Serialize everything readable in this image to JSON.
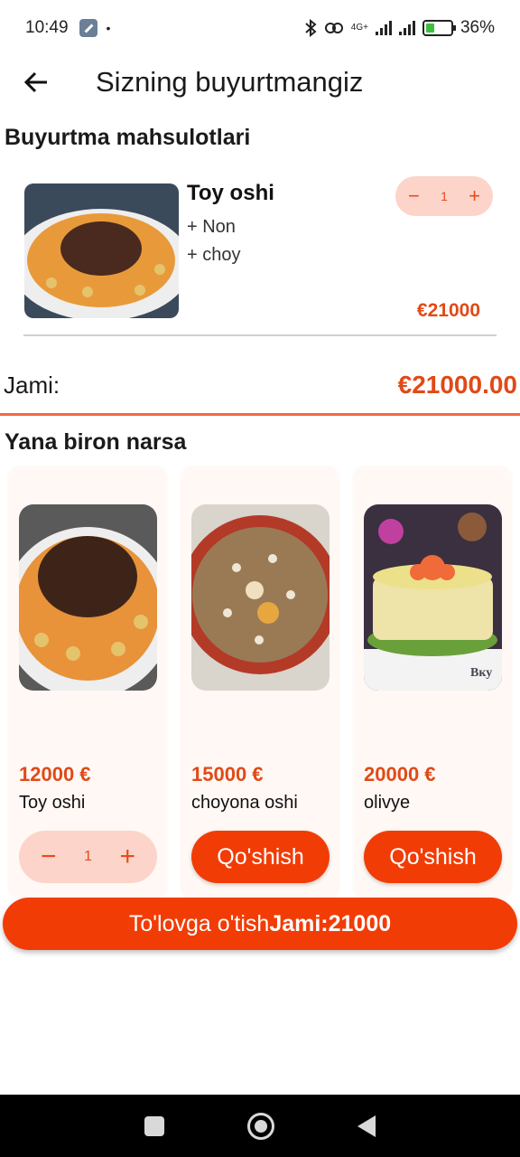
{
  "status_bar": {
    "time": "10:49",
    "dot": "•",
    "network": "4G+",
    "battery": "36%",
    "battery_level": 0.36
  },
  "app_bar": {
    "title": "Sizning buyurtmangiz"
  },
  "order_section": {
    "title": "Buyurtma mahsulotlari"
  },
  "cart_items": [
    {
      "name": "Toy oshi",
      "extras": [
        "+ Non",
        "+ choy"
      ],
      "minus": "−",
      "quantity": "1",
      "plus": "+",
      "price": "€21000"
    }
  ],
  "total": {
    "label": "Jami:",
    "value": "€21000.00"
  },
  "suggest_section": {
    "title": "Yana biron narsa"
  },
  "suggestions": [
    {
      "price": "12000 €",
      "name": "Toy oshi",
      "minus": "−",
      "quantity": "1",
      "plus": "+"
    },
    {
      "price": "15000 €",
      "name": "choyona oshi",
      "button": "Qo'shish"
    },
    {
      "price": "20000 €",
      "name": "olivye",
      "button": "Qo'shish",
      "img_text": "Вку"
    }
  ],
  "checkout": {
    "label": "To'lovga o'tish",
    "total": "Jami:21000"
  },
  "colors": {
    "accent": "#f23c05",
    "price": "#e04a18",
    "stepper_bg": "#fcd4ca",
    "card_bg": "#fff8f4"
  }
}
